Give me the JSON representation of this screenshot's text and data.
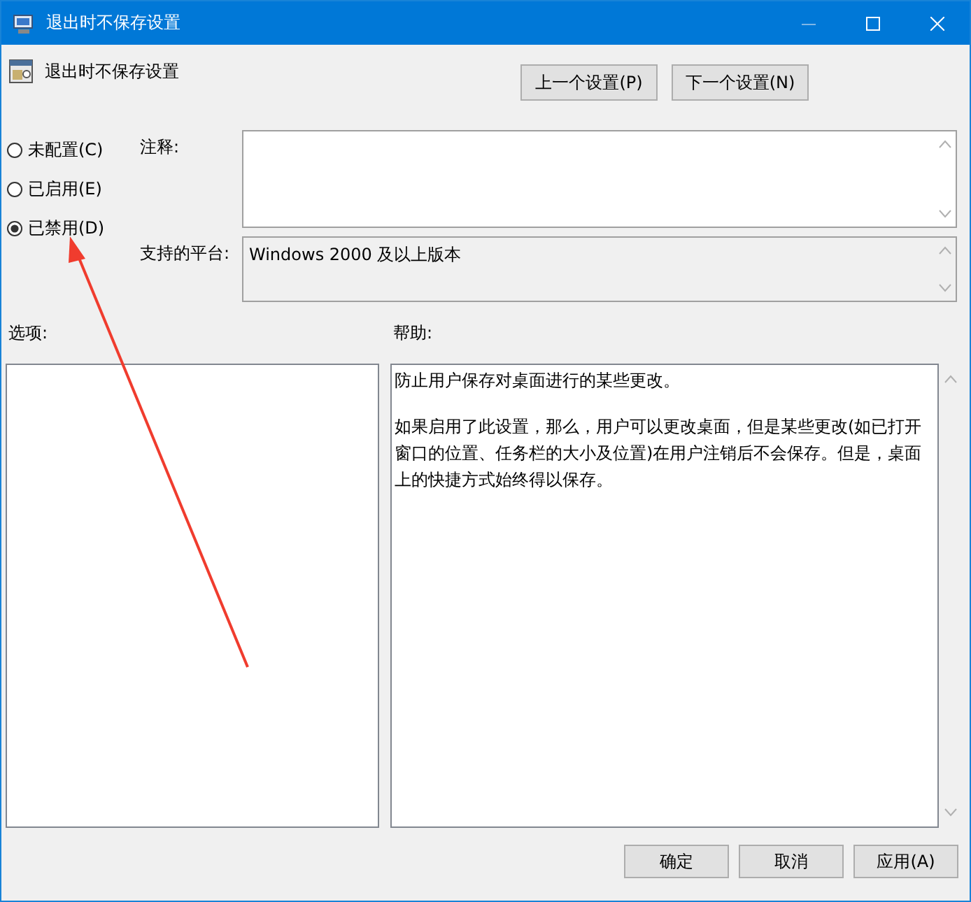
{
  "window": {
    "title": "退出时不保存设置"
  },
  "header": {
    "title": "退出时不保存设置"
  },
  "nav_buttons": [
    "上一个设置(P)",
    "下一个设置(N)"
  ],
  "state_options": [
    {
      "label": "未配置(C)",
      "selected": false
    },
    {
      "label": "已启用(E)",
      "selected": false
    },
    {
      "label": "已禁用(D)",
      "selected": true
    }
  ],
  "comment": {
    "label": "注释:"
  },
  "platform": {
    "label": "支持的平台:",
    "value": "Windows 2000 及以上版本"
  },
  "options": {
    "label": "选项:"
  },
  "help": {
    "label": "帮助:",
    "paragraphs": [
      "防止用户保存对桌面进行的某些更改。",
      "如果启用了此设置，那么，用户可以更改桌面，但是某些更改(如已打开窗口的位置、任务栏的大小及位置)在用户注销后不会保存。但是，桌面上的快捷方式始终得以保存。"
    ]
  },
  "buttons": [
    "确定",
    "取消",
    "应用(A)"
  ]
}
